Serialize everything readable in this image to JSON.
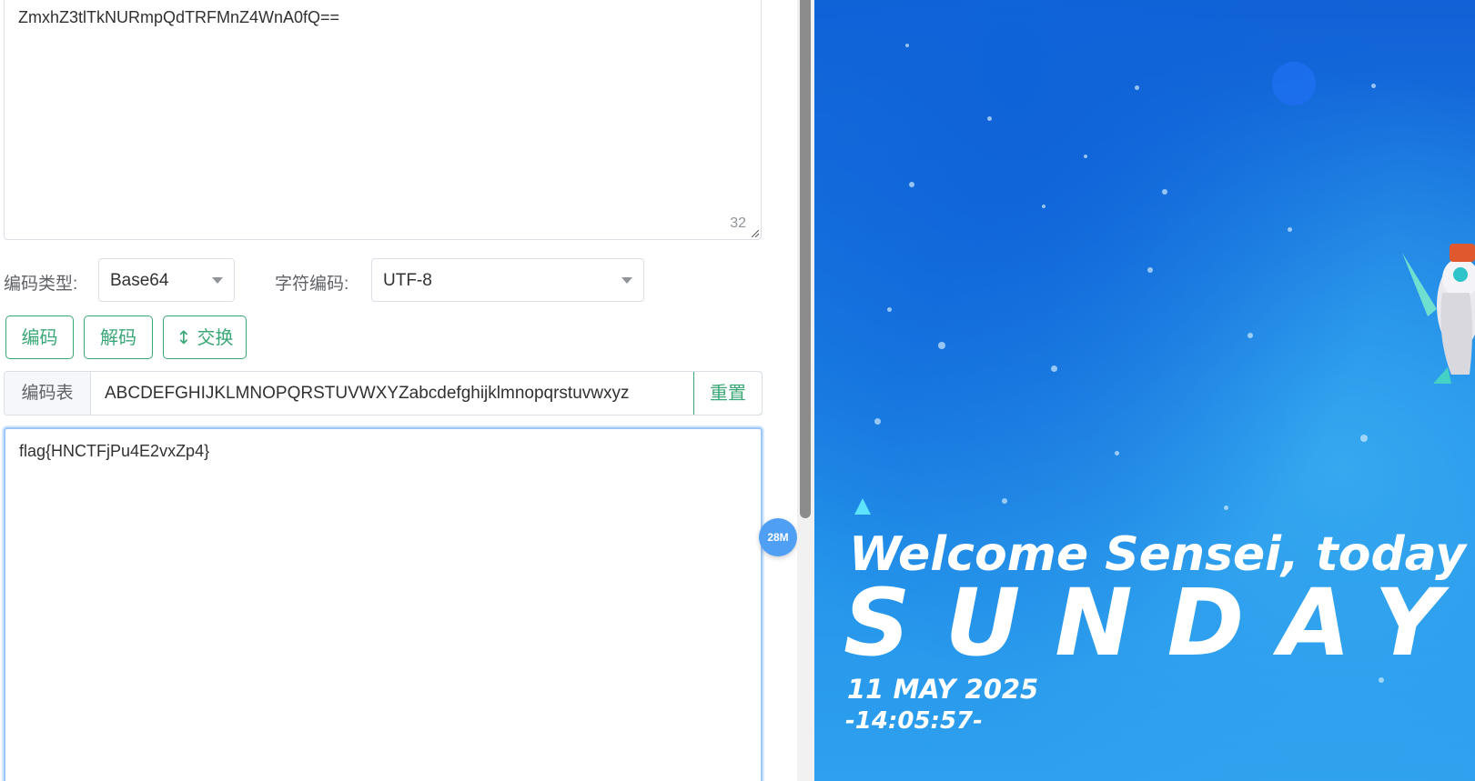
{
  "input": {
    "value": "ZmxhZ3tlTkNURmpQdTRFMnZ4WnA0fQ==",
    "char_count": "32"
  },
  "options": {
    "encode_type_label": "编码类型:",
    "encode_type_value": "Base64",
    "charset_label": "字符编码:",
    "charset_value": "UTF-8"
  },
  "buttons": {
    "encode": "编码",
    "decode": "解码",
    "swap": "↕ 交换"
  },
  "table": {
    "label": "编码表",
    "value": "ABCDEFGHIJKLMNOPQRSTUVWXYZabcdefghijklmnopqrstuvwxyz",
    "reset": "重置"
  },
  "output": {
    "value": "flag{HNCTFjPu4E2vxZp4}"
  },
  "memory_badge": "28M",
  "wallpaper": {
    "welcome": "Welcome Sensei, today is:",
    "day": "SUNDAY",
    "date": "11 MAY 2025",
    "time": "-14:05:57-"
  },
  "colors": {
    "accent_green": "#3aa876",
    "focus_blue": "#9cc6f5",
    "badge_blue": "#4f9ff5"
  }
}
